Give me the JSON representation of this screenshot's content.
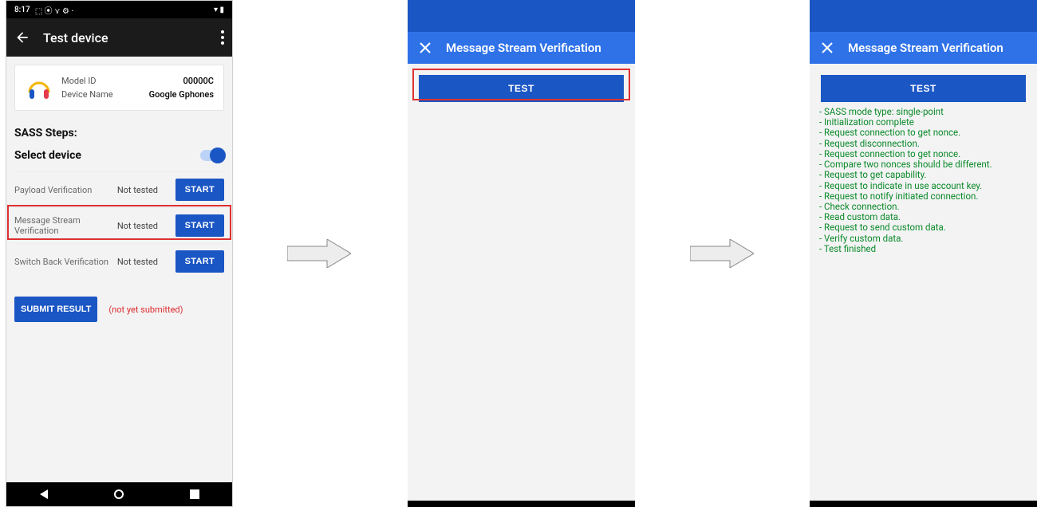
{
  "status_bar": {
    "time": "8:17",
    "left_icons": "⬚ ⦿ ⋎ ⚙ ·",
    "right_icons": "▾ ▮"
  },
  "appbar": {
    "title": "Test device"
  },
  "device_card": {
    "model_id_label": "Model ID",
    "model_id_value": "00000C",
    "device_name_label": "Device Name",
    "device_name_value": "Google Gphones"
  },
  "section": {
    "steps_heading": "SASS Steps:",
    "select_device": "Select device"
  },
  "steps": [
    {
      "name": "Payload Verification",
      "status": "Not tested",
      "action": "START"
    },
    {
      "name": "Message Stream Verification",
      "status": "Not tested",
      "action": "START"
    },
    {
      "name": "Switch Back Verification",
      "status": "Not tested",
      "action": "START"
    }
  ],
  "submit": {
    "button": "SUBMIT RESULT",
    "hint": "(not yet submitted)"
  },
  "msv": {
    "title": "Message Stream Verification",
    "test_button": "TEST"
  },
  "log_lines": [
    "SASS mode type: single-point",
    "Initialization complete",
    "Request connection to get nonce.",
    "Request disconnection.",
    "Request connection to get nonce.",
    "Compare two nonces should be different.",
    "Request to get capability.",
    "Request to indicate in use account key.",
    "Request to notify initiated connection.",
    "Check connection.",
    "Read custom data.",
    "Request to send custom data.",
    "Verify custom data.",
    "Test finished"
  ]
}
